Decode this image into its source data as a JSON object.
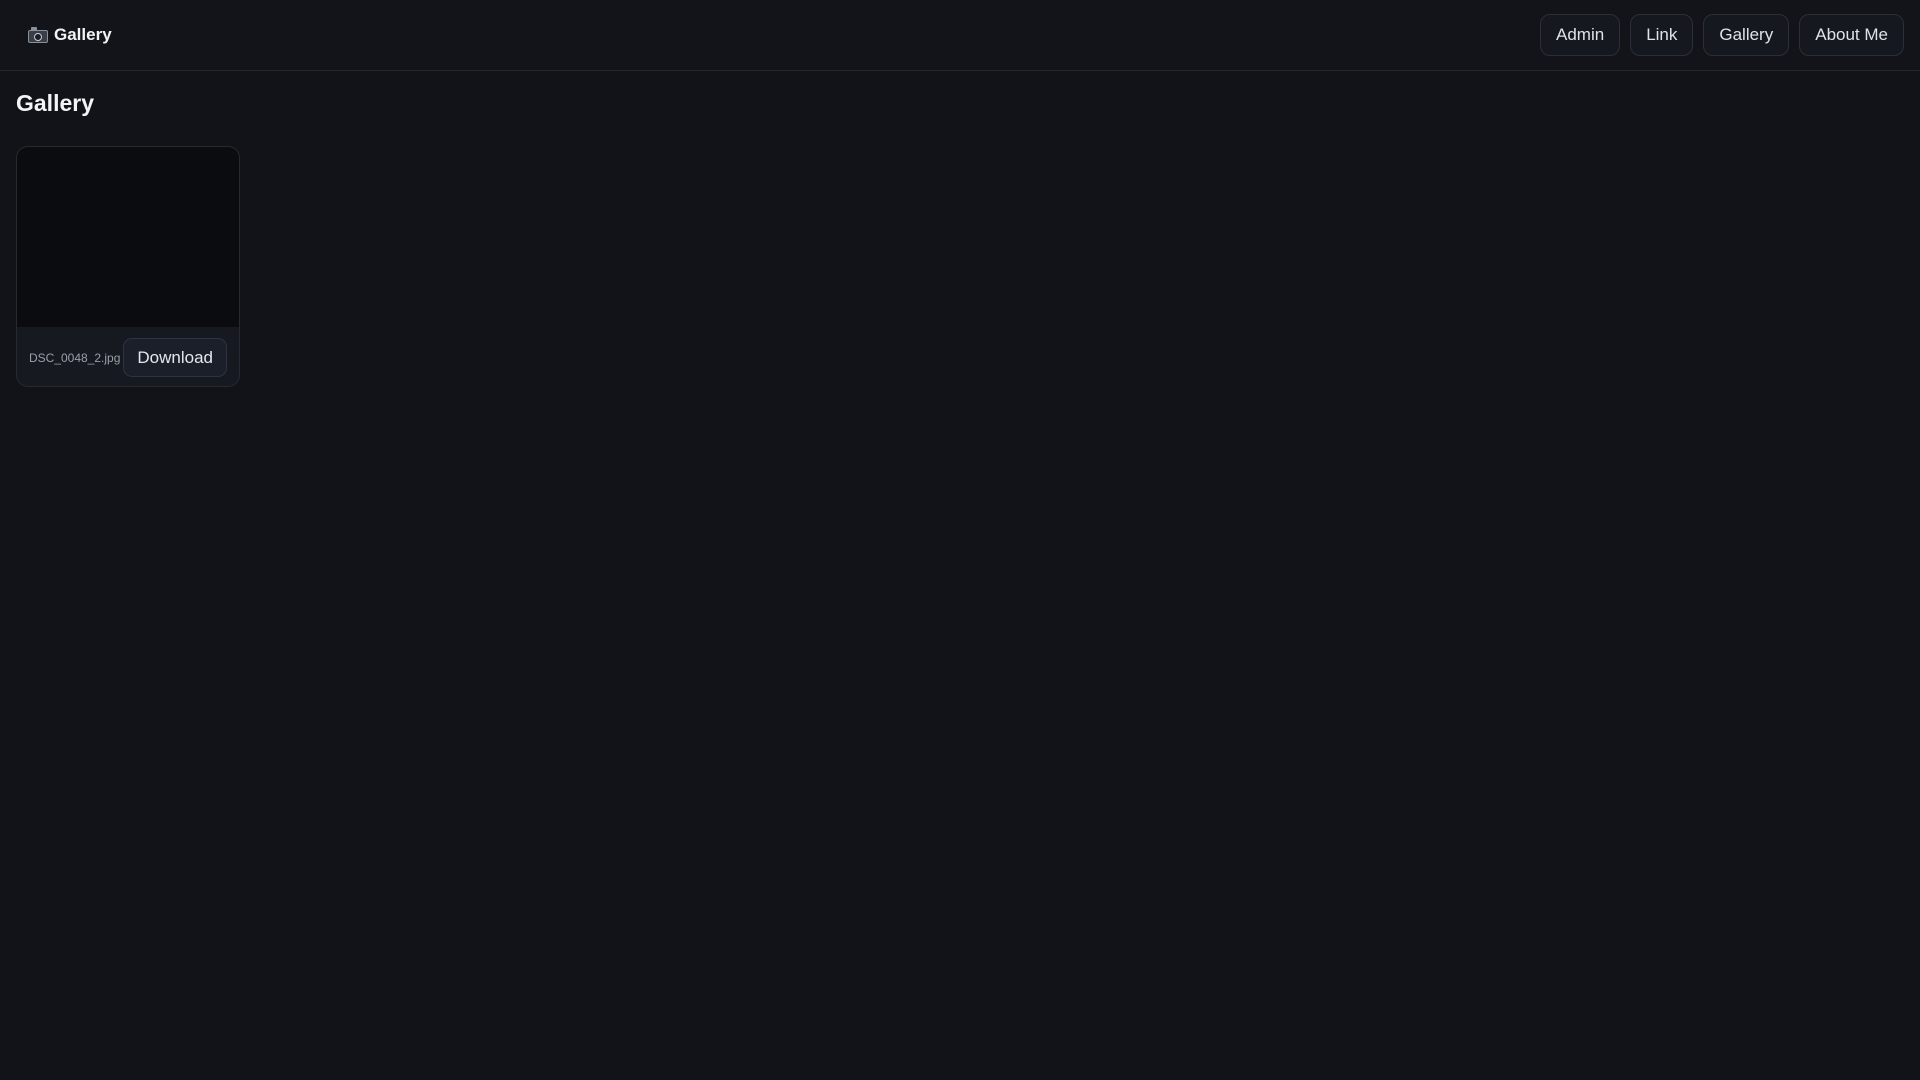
{
  "header": {
    "brand_label": "Gallery",
    "brand_icon": "camera-icon"
  },
  "nav": {
    "items": [
      {
        "label": "Admin"
      },
      {
        "label": "Link"
      },
      {
        "label": "Gallery"
      },
      {
        "label": "About Me"
      }
    ]
  },
  "main": {
    "title": "Gallery",
    "photos": [
      {
        "filename": "DSC_0048_2.jpg",
        "download_label": "Download"
      }
    ]
  },
  "colors": {
    "background": "#111318",
    "surface": "#15181f",
    "border": "#2b2f38",
    "thumbnail": "#0a0c10",
    "text": "#e8eaed",
    "muted_text": "#9aa0a8"
  }
}
